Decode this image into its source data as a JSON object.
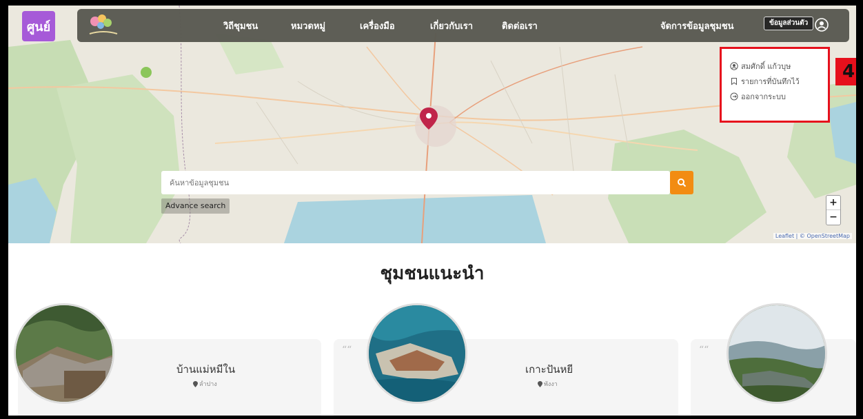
{
  "logo": {
    "text": "ศูนย์"
  },
  "nav": {
    "items": [
      {
        "label": "วิถีชุมชน"
      },
      {
        "label": "หมวดหมู่"
      },
      {
        "label": "เครื่องมือ"
      },
      {
        "label": "เกี่ยวกับเรา"
      },
      {
        "label": "ติดต่อเรา"
      }
    ],
    "manage_label": "จัดการข้อมูลชุมชน",
    "apply_label": "ข้อมูลส่วนตัว"
  },
  "user_menu": {
    "items": [
      {
        "label": "สมศักดิ์ แก้วบุษ",
        "icon": "user-circle-icon"
      },
      {
        "label": "รายการที่บันทึกไว้",
        "icon": "bookmark-icon"
      },
      {
        "label": "ออกจากระบบ",
        "icon": "logout-icon"
      }
    ],
    "step_number": "4"
  },
  "search": {
    "placeholder": "ค้นหาข้อมูลชุมชน",
    "advance_label": "Advance search"
  },
  "map": {
    "zoom_in": "+",
    "zoom_out": "−",
    "attribution": "Leaflet | © OpenStreetMap"
  },
  "section": {
    "title": "ชุมชนแนะนำ"
  },
  "cards": [
    {
      "name": "บ้านแม่หมีใน",
      "location": "ลำปาง"
    },
    {
      "name": "เกาะปันหยี",
      "location": "พังงา"
    },
    {
      "name": "",
      "location": ""
    }
  ],
  "colors": {
    "accent_orange": "#f28c12",
    "logo_purple": "#a65ad8",
    "highlight_red": "#e6101c",
    "navbar": "#5a5a52"
  }
}
